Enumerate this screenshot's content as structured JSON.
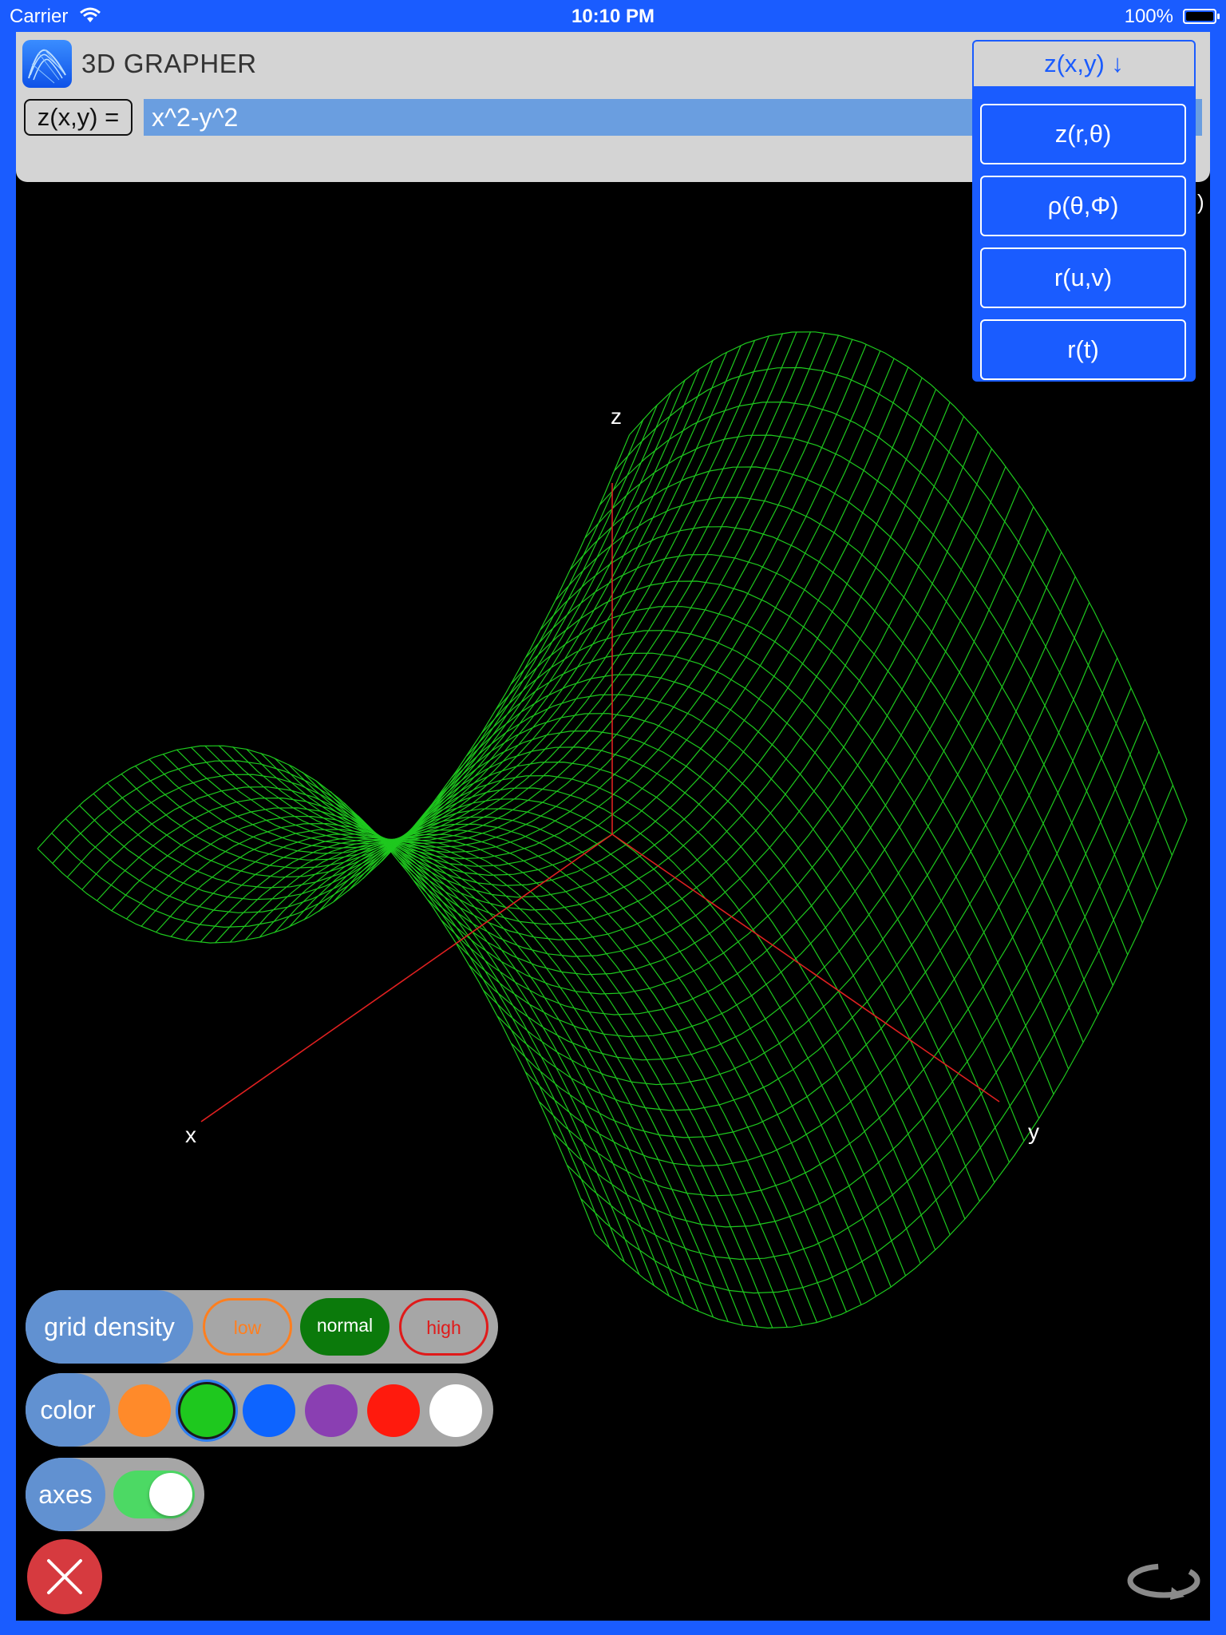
{
  "status_bar": {
    "carrier": "Carrier",
    "time": "10:10 PM",
    "battery": "100%"
  },
  "header": {
    "app_title": "3D GRAPHER",
    "function_type_label": "z(x,y) =",
    "equation": "x^2-y^2"
  },
  "function_menu": {
    "current": "z(x,y) ↓",
    "options": [
      "z(r,θ)",
      "ρ(θ,Φ)",
      "r(u,v)",
      "r(t)"
    ]
  },
  "edge_glyph": ")",
  "graph": {
    "function": "x^2-y^2",
    "surface_color": "#1ec81e",
    "axes_color": "#e02020",
    "axis_labels": {
      "x": "x",
      "y": "y",
      "z": "z"
    },
    "axes_visible": true
  },
  "controls": {
    "grid_density": {
      "label": "grid density",
      "options": [
        "low",
        "normal",
        "high"
      ],
      "selected": "normal"
    },
    "color": {
      "label": "color",
      "swatches": [
        "#ff8a2a",
        "#1ec81e",
        "#0d64ff",
        "#8a3fb2",
        "#ff1a0d",
        "#ffffff"
      ],
      "selected_index": 1
    },
    "axes": {
      "label": "axes",
      "enabled": true
    }
  },
  "icons": {
    "close": "close-icon",
    "rotate": "rotate-icon",
    "app": "app-icon"
  }
}
